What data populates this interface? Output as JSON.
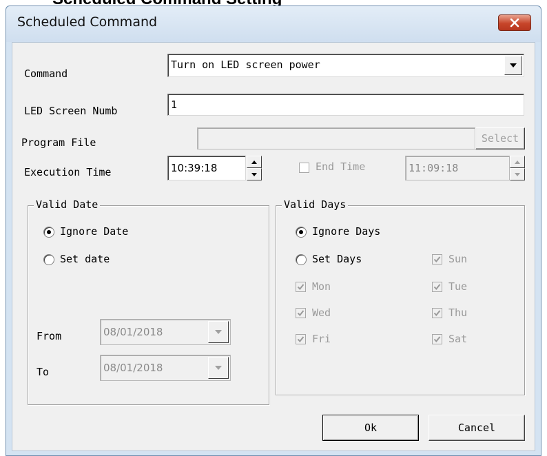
{
  "page_heading": "Scheduled Command Setting",
  "window": {
    "title": "Scheduled Command",
    "close_icon": "close-x-icon"
  },
  "command": {
    "label": "Command",
    "selected": "Turn on LED screen power"
  },
  "led_screen": {
    "label": "LED Screen Numb",
    "value": "1"
  },
  "program_file": {
    "label": "Program File",
    "value": "",
    "select_button": "Select"
  },
  "execution_time": {
    "label": "Execution Time",
    "value": "10:39:18",
    "end_time_label": "End Time",
    "end_time_checked": false,
    "end_time_value": "11:09:18"
  },
  "valid_date": {
    "title": "Valid Date",
    "ignore_label": "Ignore Date",
    "set_label": "Set date",
    "selected": "ignore",
    "from_label": "From",
    "from_value": "08/01/2018",
    "to_label": "To",
    "to_value": "08/01/2018"
  },
  "valid_days": {
    "title": "Valid Days",
    "ignore_label": "Ignore Days",
    "set_label": "Set Days",
    "selected": "ignore",
    "days": {
      "sun": "Sun",
      "mon": "Mon",
      "tue": "Tue",
      "wed": "Wed",
      "thu": "Thu",
      "fri": "Fri",
      "sat": "Sat"
    }
  },
  "buttons": {
    "ok": "Ok",
    "cancel": "Cancel"
  },
  "colors": {
    "frame": "#d4e3f2",
    "client": "#f0f0f0",
    "close_button": "#c7452a",
    "disabled_text": "#9a9a9a"
  }
}
